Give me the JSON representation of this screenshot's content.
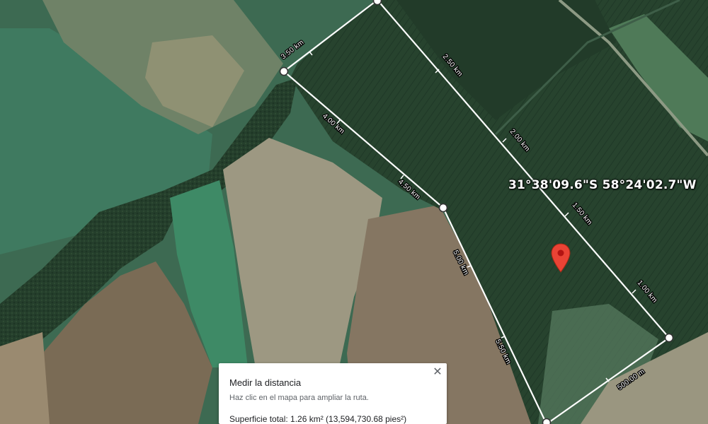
{
  "map": {
    "coordinates": "31°38'09.6\"S 58°24'02.7\"W",
    "distance_labels": [
      "3.50 km",
      "2.50 km",
      "2.00 km",
      "4.00 km",
      "4.50 km",
      "1.50 km",
      "5.00 km",
      "1.00 km",
      "5.50 km",
      "500.00 m"
    ],
    "colors": {
      "measure_line": "#ffffff",
      "pin": "#ea4335",
      "forest": "#243f2b",
      "field_light": "#9a9a80",
      "field_brown": "#8a7a62",
      "field_green": "#3f8a68"
    }
  },
  "measure_panel": {
    "title": "Medir la distancia",
    "hint": "Haz clic en el mapa para ampliar la ruta.",
    "total": "Superficie total: 1.26 km² (13,594,730.68 pies²)",
    "close_icon": "close-icon"
  }
}
